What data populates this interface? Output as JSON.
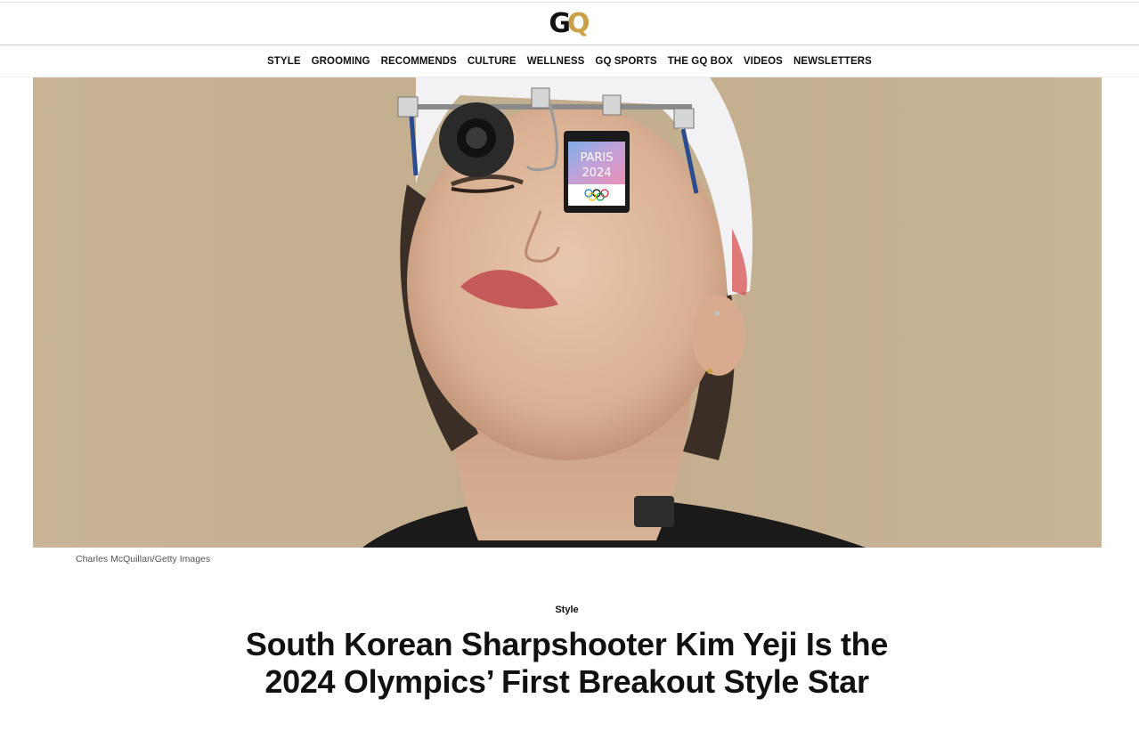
{
  "brand": {
    "logo_g": "G",
    "logo_q": "Q",
    "logo_primary_color": "#111111",
    "logo_accent_color": "#c8a14a"
  },
  "nav": {
    "items": [
      "STYLE",
      "GROOMING",
      "RECOMMENDS",
      "CULTURE",
      "WELLNESS",
      "GQ SPORTS",
      "THE GQ BOX",
      "VIDEOS",
      "NEWSLETTERS"
    ]
  },
  "hero": {
    "badge_line1": "PARIS",
    "badge_line2": "2024",
    "credit": "Charles McQuillan/Getty Images"
  },
  "article": {
    "rubric": "Style",
    "headline": "South Korean Sharpshooter Kim Yeji Is the 2024 Olympics’ First Breakout Style Star"
  }
}
